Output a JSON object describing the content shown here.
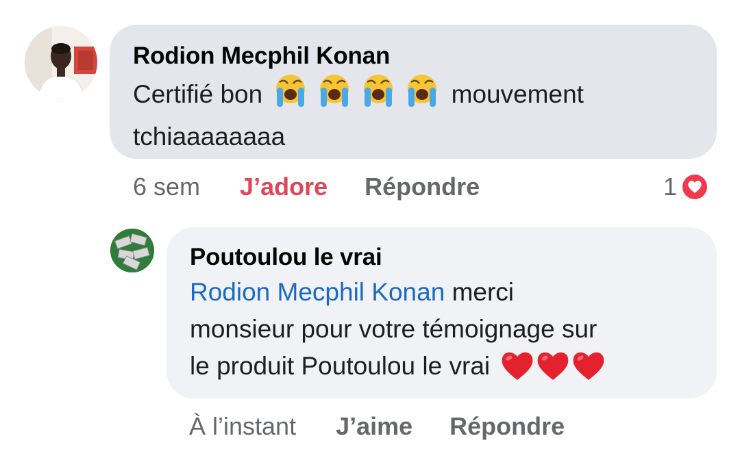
{
  "comments": [
    {
      "author": "Rodion Mecphil Konan",
      "text_before": "Certifié bon",
      "emoji_icons": [
        "loudly-crying-face-icon",
        "loudly-crying-face-icon",
        "loudly-crying-face-icon",
        "loudly-crying-face-icon"
      ],
      "text_after": "mouvement",
      "text_line2": "tchiaaaaaaaa",
      "time": "6 sem",
      "like_label": "J’adore",
      "reply_label": "Répondre",
      "reaction_count": "1",
      "reaction_icon": "heart-reaction-icon"
    },
    {
      "author": "Poutoulou le vrai",
      "mention": "Rodion Mecphil Konan",
      "text_line1_rest": "merci",
      "text_line2": "monsieur pour votre témoignage sur",
      "text_line3": "le produit Poutoulou le vrai",
      "emoji_icons": [
        "red-heart-icon",
        "red-heart-icon",
        "red-heart-icon"
      ],
      "time": "À l’instant",
      "like_label": "J’aime",
      "reply_label": "Répondre"
    }
  ],
  "colors": {
    "bubble_primary": "#e4e6eb",
    "bubble_secondary": "#f0f2f5",
    "mention": "#1a6ac4",
    "love": "#e0455a",
    "meta": "#65676b"
  }
}
